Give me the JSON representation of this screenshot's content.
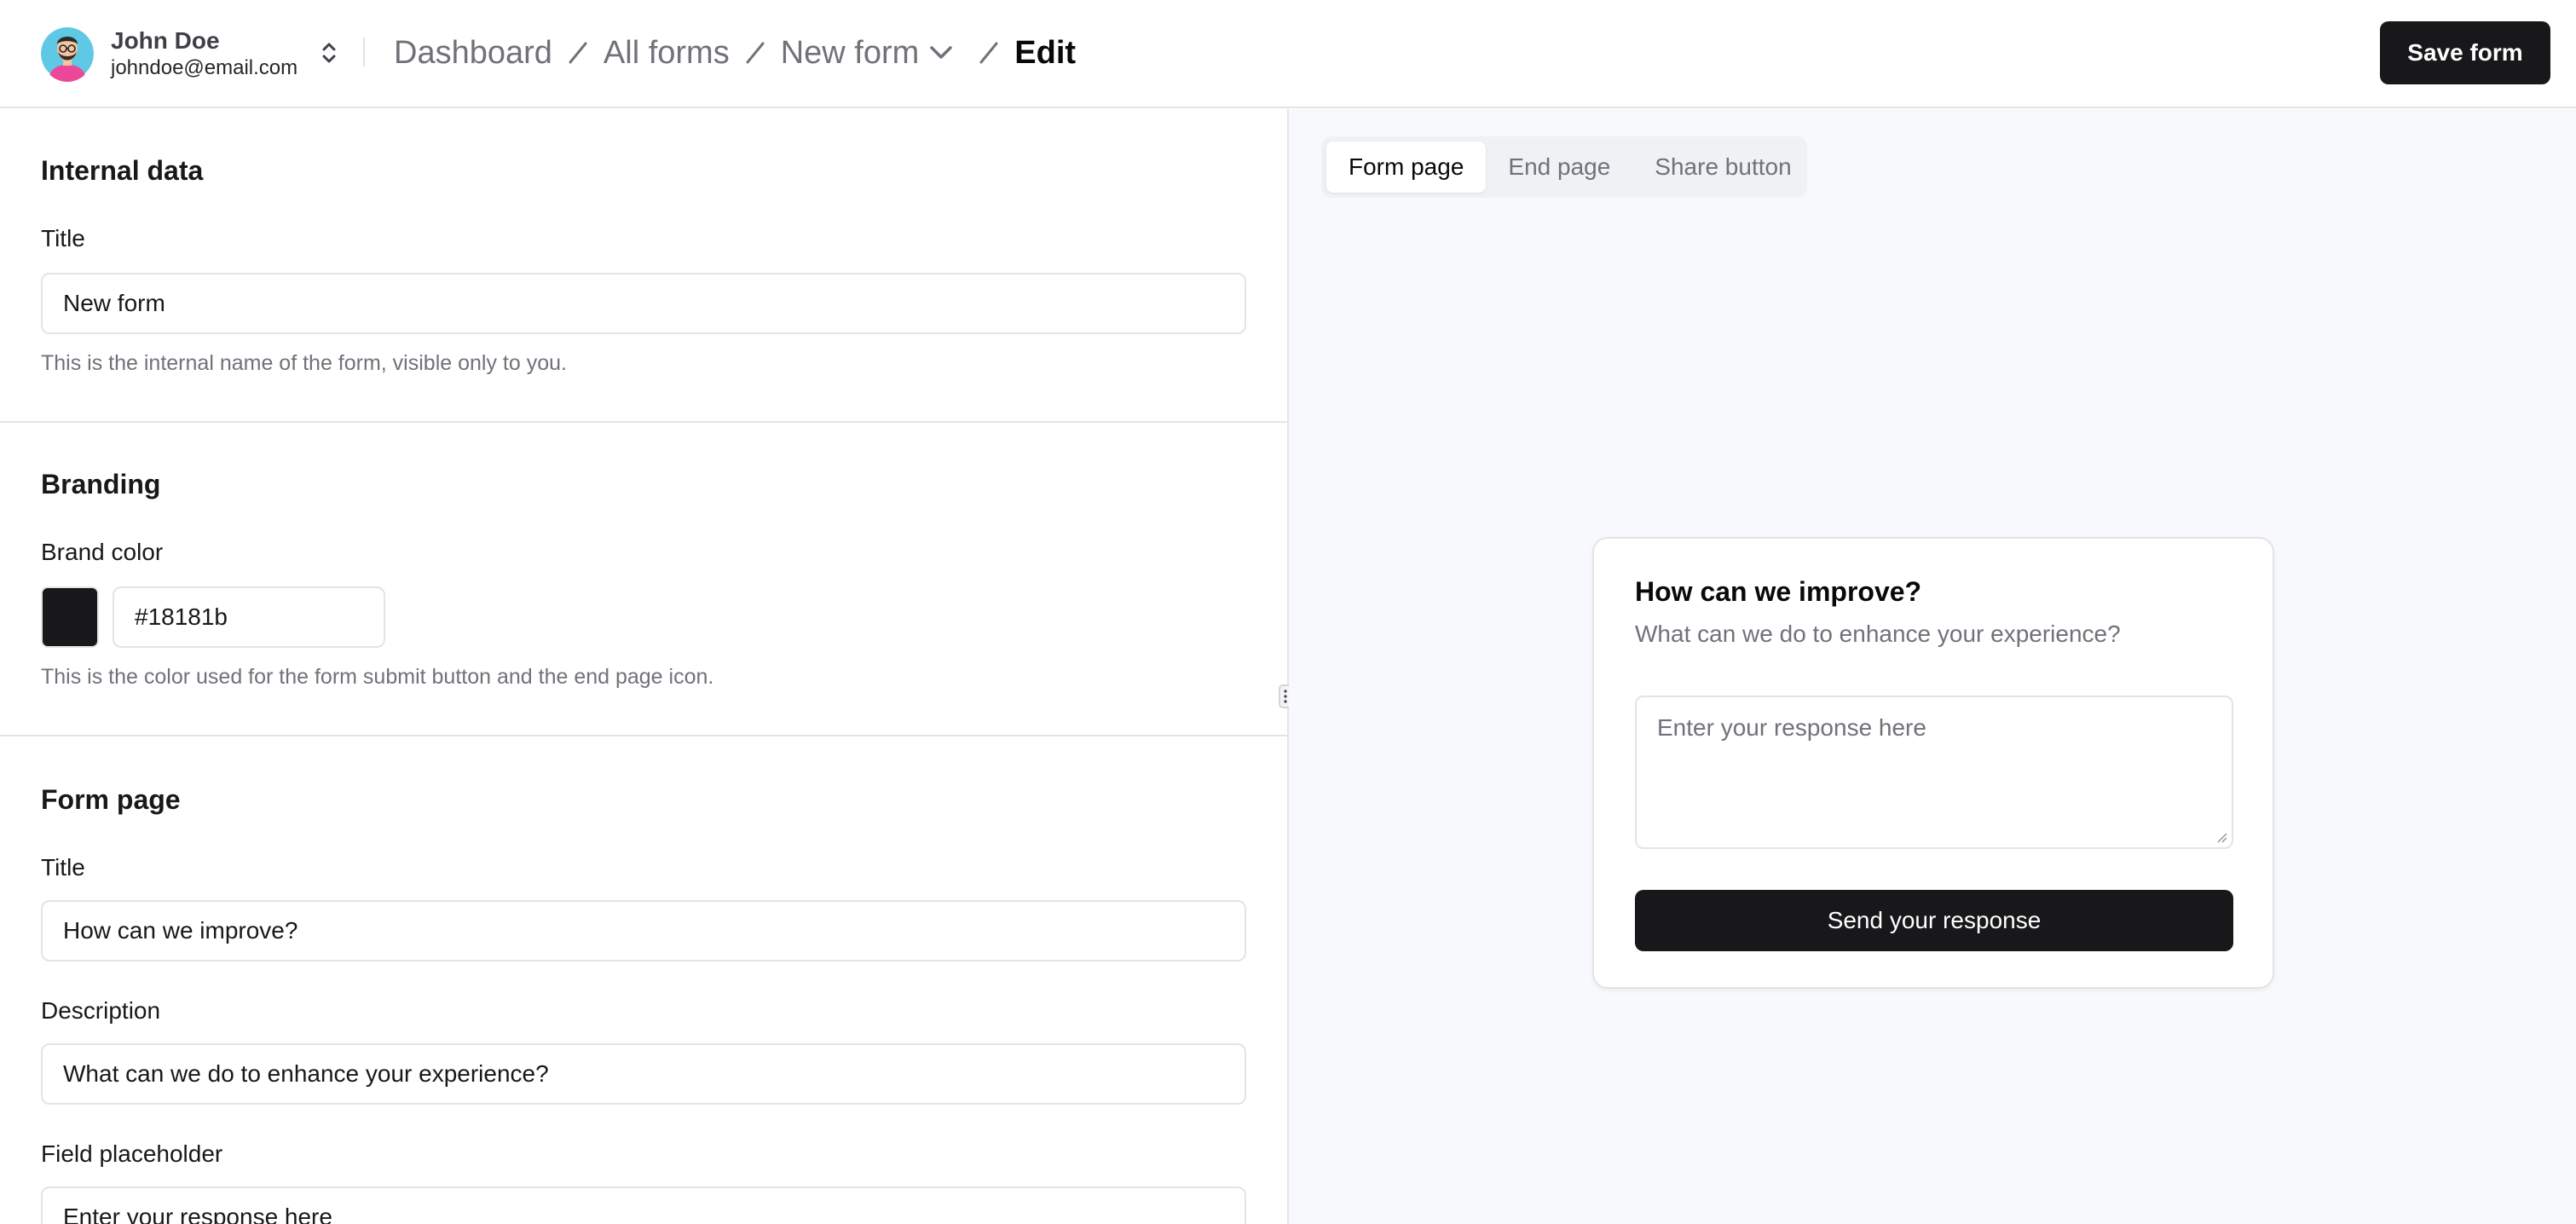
{
  "user": {
    "name": "John Doe",
    "email": "johndoe@email.com",
    "avatar_icon": "avatar-illustration",
    "switch_icon": "chevrons-up-down-icon"
  },
  "breadcrumb": {
    "items": [
      "Dashboard",
      "All forms",
      "New form"
    ],
    "current": "Edit",
    "dropdown_icon": "chevron-down-icon"
  },
  "header": {
    "save_label": "Save form"
  },
  "internal_data": {
    "heading": "Internal data",
    "title_label": "Title",
    "title_value": "New form",
    "help": "This is the internal name of the form, visible only to you."
  },
  "branding": {
    "heading": "Branding",
    "color_label": "Brand color",
    "color_value": "#18181b",
    "help": "This is the color used for the form submit button and the end page icon."
  },
  "form_page": {
    "heading": "Form page",
    "title_label": "Title",
    "title_value": "How can we improve?",
    "description_label": "Description",
    "description_value": "What can we do to enhance your experience?",
    "placeholder_label": "Field placeholder",
    "placeholder_value": "Enter your response here"
  },
  "preview": {
    "tabs": [
      "Form page",
      "End page",
      "Share button"
    ],
    "active_tab": "Form page",
    "title": "How can we improve?",
    "description": "What can we do to enhance your experience?",
    "placeholder": "Enter your response here",
    "submit_label": "Send your response"
  },
  "colors": {
    "brand": "#18181b",
    "border": "#e4e4e7",
    "muted_text": "#71717a",
    "preview_bg": "#f8f9fc"
  }
}
